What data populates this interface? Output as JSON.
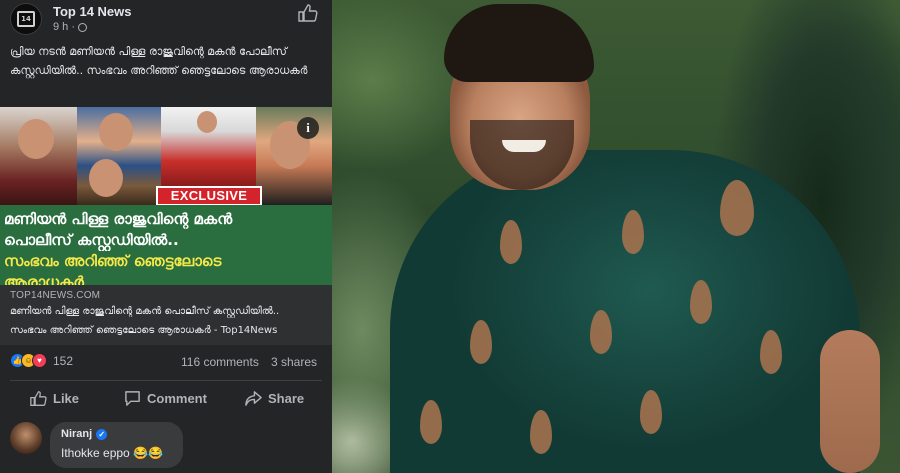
{
  "post": {
    "page_name": "Top 14 News",
    "time": "9 h ·",
    "text": "പ്രിയ നടൻ മണിയൻ പിള്ള രാജുവിന്റെ മകൻ പോലീസ് കസ്റ്റഡിയിൽ.. സംഭവം അറിഞ്ഞ് ഞെട്ടലോടെ ആരാധകർ",
    "logo_text": "14"
  },
  "link_preview": {
    "badge": "EXCLUSIVE",
    "headline_line1": "മണിയൻ പിള്ള രാജുവിന്റെ മകൻ",
    "headline_line2": "പൊലീസ് കസ്റ്റഡിയിൽ..",
    "headline_line3": "സംഭവം അറിഞ്ഞ് ഞെട്ടലോടെ",
    "headline_line4": "ആരാധകർ",
    "domain": "TOP14NEWS.COM",
    "title_line1": "മണിയൻ പിള്ള രാജുവിന്റെ മകൻ പൊലീസ് കസ്റ്റഡിയിൽ..",
    "title_line2": "സംഭവം അറിഞ്ഞ് ഞെട്ടലോടെ ആരാധകർ - Top14News",
    "info_glyph": "i"
  },
  "stats": {
    "reaction_count": "152",
    "comments": "116 comments",
    "shares": "3 shares",
    "reaction_icons": [
      "like-icon",
      "haha-icon",
      "love-icon"
    ]
  },
  "actions": {
    "like": "Like",
    "comment": "Comment",
    "share": "Share"
  },
  "comment": {
    "name": "Niranj",
    "text": "Ithokke eppo 😂😂"
  },
  "colors": {
    "panel_bg": "#242526",
    "text_primary": "#e4e6eb",
    "text_secondary": "#b0b3b8",
    "headline_green": "#2a6e3f",
    "headline_yellow": "#f5e84a",
    "exclusive_red": "#d3232b",
    "fb_blue": "#1877f2"
  }
}
